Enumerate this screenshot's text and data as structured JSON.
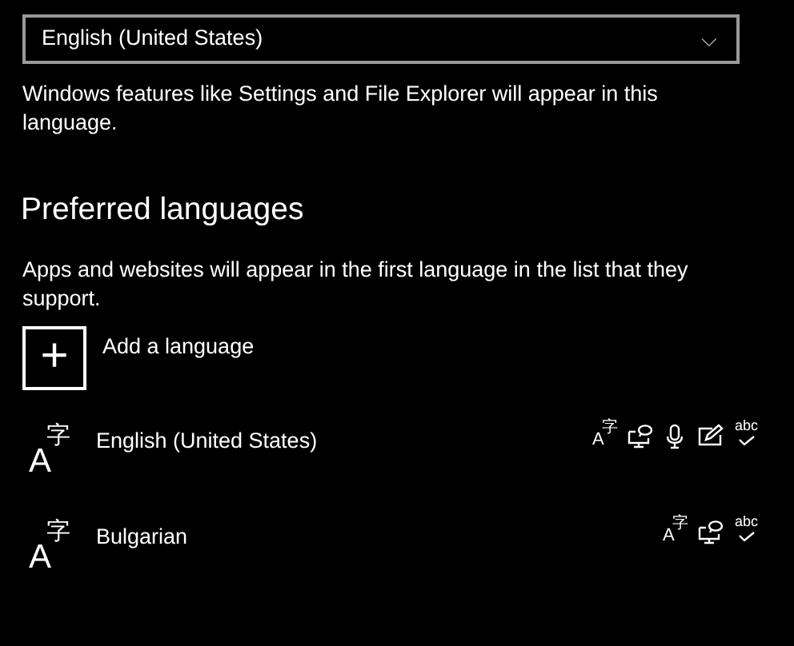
{
  "display_language": {
    "value": "English (United States)",
    "caret": "⌵"
  },
  "display_note": "Windows features like Settings and File Explorer will appear in this language.",
  "preferred": {
    "heading": "Preferred languages",
    "note": "Apps and websites will appear in the first language in the list that they support.",
    "add_button": {
      "icon": "+",
      "label": "Add a language"
    },
    "languages": [
      {
        "name": "English (United States)",
        "icon_main": "A",
        "icon_sup": "字",
        "features": [
          {
            "kind": "display",
            "main": "A",
            "sup": "字"
          },
          {
            "kind": "text-to-speech"
          },
          {
            "kind": "speech"
          },
          {
            "kind": "handwriting"
          },
          {
            "kind": "spelling",
            "glyph": "abc"
          }
        ]
      },
      {
        "name": "Bulgarian",
        "icon_main": "A",
        "icon_sup": "字",
        "features": [
          {
            "kind": "display",
            "main": "A",
            "sup": "字"
          },
          {
            "kind": "text-to-speech"
          },
          {
            "kind": "spelling",
            "glyph": "abc"
          }
        ]
      }
    ]
  }
}
